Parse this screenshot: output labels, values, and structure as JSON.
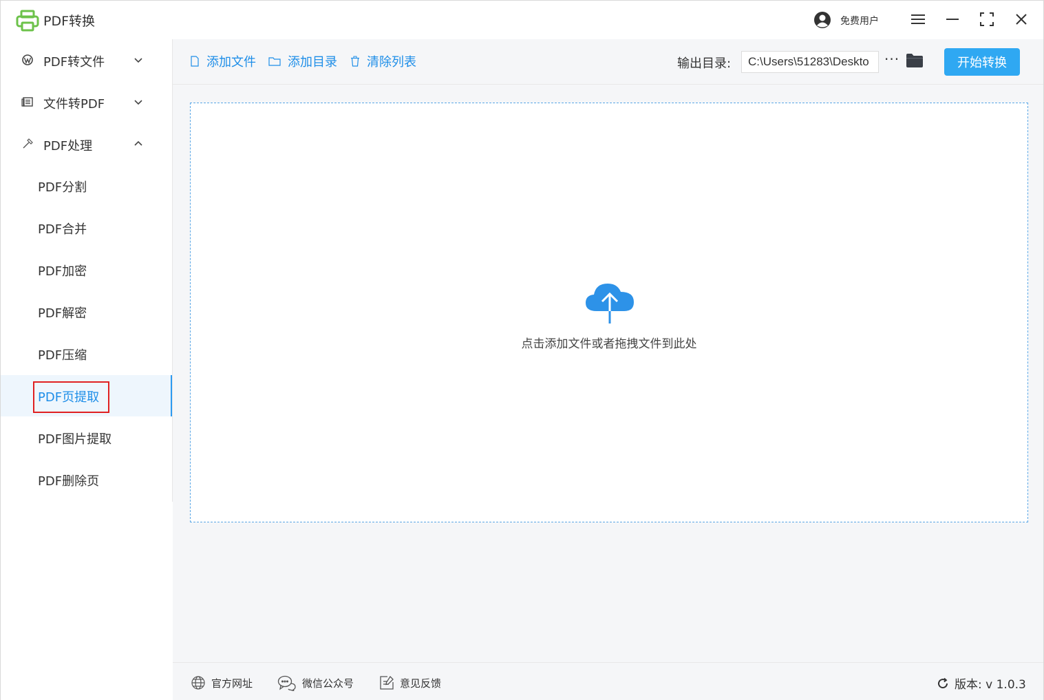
{
  "app": {
    "title": "PDF转换",
    "logo_icon": "printer-icon",
    "accent": "#2fa8f2",
    "logo_color": "#6cc24a"
  },
  "user": {
    "label": "免费用户"
  },
  "sidebar": {
    "groups": [
      {
        "label": "PDF转文件",
        "icon": "wordpress-icon",
        "expanded": false
      },
      {
        "label": "文件转PDF",
        "icon": "document-icon",
        "expanded": false
      },
      {
        "label": "PDF处理",
        "icon": "hammer-icon",
        "expanded": true
      }
    ],
    "sub_items": [
      {
        "label": "PDF分割"
      },
      {
        "label": "PDF合并"
      },
      {
        "label": "PDF加密"
      },
      {
        "label": "PDF解密"
      },
      {
        "label": "PDF压缩"
      },
      {
        "label": "PDF页提取"
      },
      {
        "label": "PDF图片提取"
      },
      {
        "label": "PDF删除页"
      }
    ],
    "active_item": "PDF页提取"
  },
  "toolbar": {
    "add_file": "添加文件",
    "add_folder": "添加目录",
    "clear_list": "清除列表",
    "output_label": "输出目录:",
    "output_path": "C:\\Users\\51283\\Deskto",
    "more": "···",
    "start": "开始转换"
  },
  "dropzone": {
    "text": "点击添加文件或者拖拽文件到此处"
  },
  "footer": {
    "website": "官方网址",
    "wechat": "微信公众号",
    "feedback": "意见反馈",
    "version": "版本: v 1.0.3"
  }
}
